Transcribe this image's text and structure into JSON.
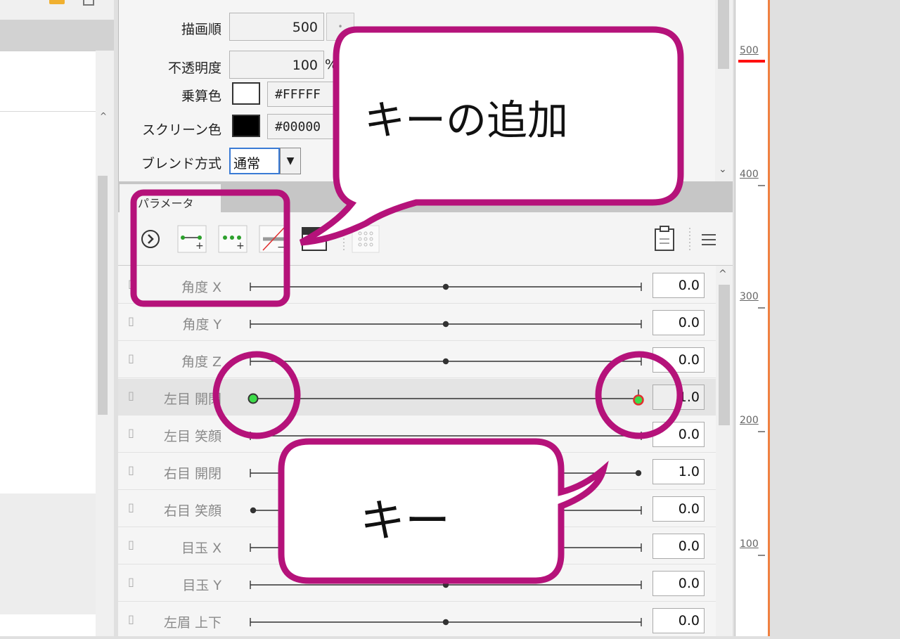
{
  "left_panel": {},
  "properties": {
    "draw_order_label": "描画順",
    "draw_order_value": "500",
    "opacity_label": "不透明度",
    "opacity_value": "100",
    "opacity_unit": "%",
    "multiply_label": "乗算色",
    "multiply_hex": "#FFFFF",
    "screen_label": "スクリーン色",
    "screen_hex": "#00000",
    "blend_label": "ブレンド方式",
    "blend_value": "通常"
  },
  "parameters": {
    "tab_label": "パラメータ",
    "rows": [
      {
        "name": "角度 X",
        "value": "0.0"
      },
      {
        "name": "角度 Y",
        "value": "0.0"
      },
      {
        "name": "角度 Z",
        "value": "0.0"
      },
      {
        "name": "左目 開閉",
        "value": "1.0"
      },
      {
        "name": "左目 笑顔",
        "value": "0.0"
      },
      {
        "name": "右目 開閉",
        "value": "1.0"
      },
      {
        "name": "右目 笑顔",
        "value": "0.0"
      },
      {
        "name": "目玉 X",
        "value": "0.0"
      },
      {
        "name": "目玉 Y",
        "value": "0.0"
      },
      {
        "name": "左眉 上下",
        "value": "0.0"
      }
    ],
    "link_icon": "link-icon"
  },
  "ruler": {
    "labels": [
      "500",
      "400",
      "300",
      "200",
      "100"
    ]
  },
  "annotations": {
    "callout_add_key": "キーの追加",
    "callout_key": "キー",
    "accent_color": "#b5127a"
  }
}
